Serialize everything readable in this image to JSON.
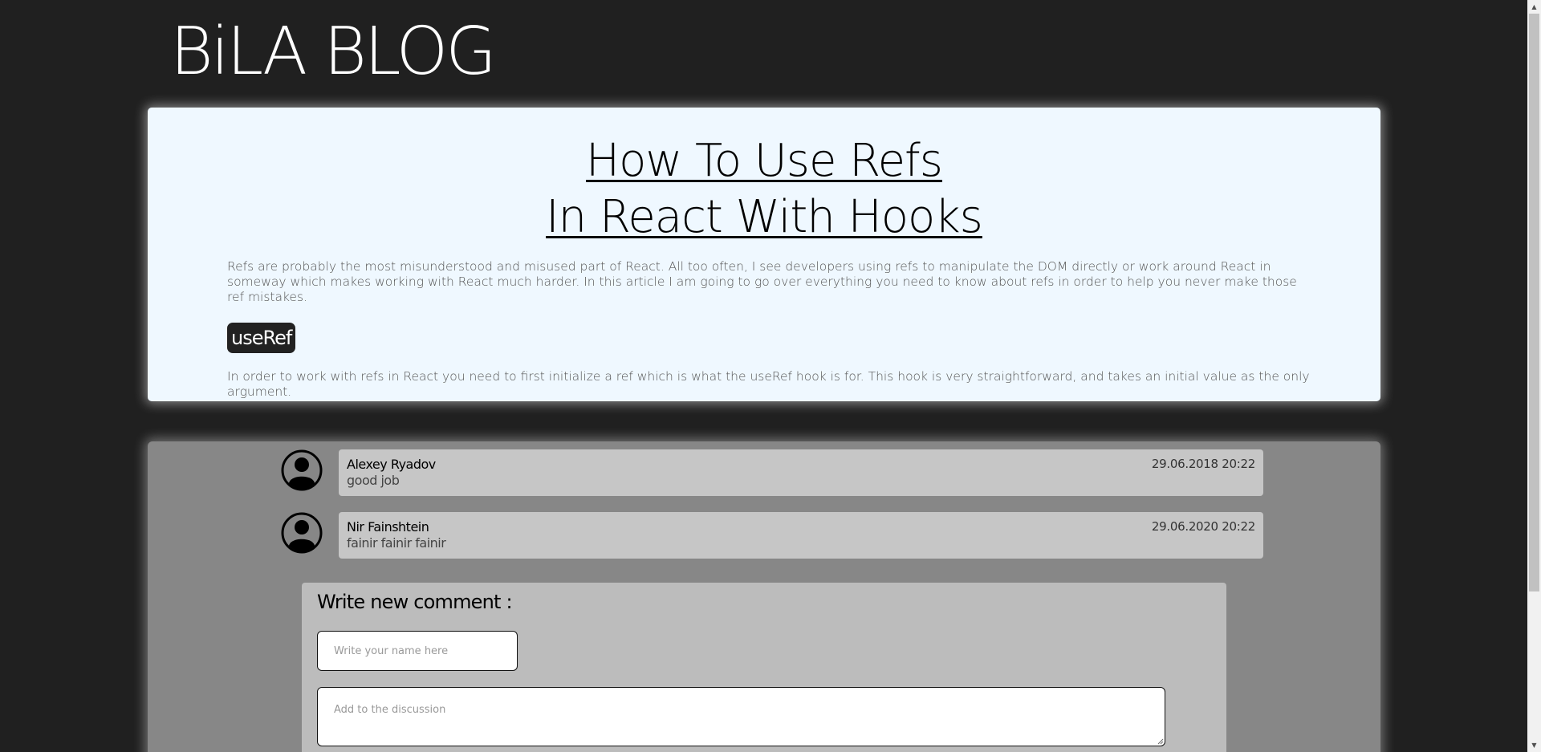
{
  "site": {
    "title": "BiLA BLOG"
  },
  "article": {
    "title_line1": "How To Use Refs",
    "title_line2": "In React With Hooks",
    "intro": "Refs are probably the most misunderstood and misused part of React. All too often, I see developers using refs to manipulate the DOM directly or work around React in someway which makes working with React much harder. In this article I am going to go over everything you need to know about refs in order to help you never make those ref mistakes.",
    "section_badge": "useRef",
    "section_text": "In order to work with refs in React you need to first initialize a ref which is what the useRef hook is for. This hook is very straightforward, and takes an initial value as the only argument."
  },
  "comments": [
    {
      "author": "Alexey Ryadov",
      "date": "29.06.2018 20:22",
      "text": "good job",
      "avatar_icon": "user-avatar-icon"
    },
    {
      "author": "Nir Fainshtein",
      "date": "29.06.2020 20:22",
      "text": "fainir fainir fainir",
      "avatar_icon": "user-avatar-icon"
    }
  ],
  "new_comment": {
    "title": "Write new comment :",
    "name_placeholder": "Write your name here",
    "name_value": "",
    "discussion_placeholder": "Add to the discussion",
    "discussion_value": ""
  },
  "colors": {
    "page_background": "#202020",
    "article_background": "#eff8ff",
    "comments_background": "#878787",
    "comment_bubble": "#c6c6c6",
    "new_comment_background": "#bcbcbc",
    "badge_background": "#222222"
  },
  "icons": {
    "scroll_up": "scroll-up-arrow-icon",
    "scroll_down": "scroll-down-arrow-icon",
    "resize": "resize-grip-icon"
  }
}
